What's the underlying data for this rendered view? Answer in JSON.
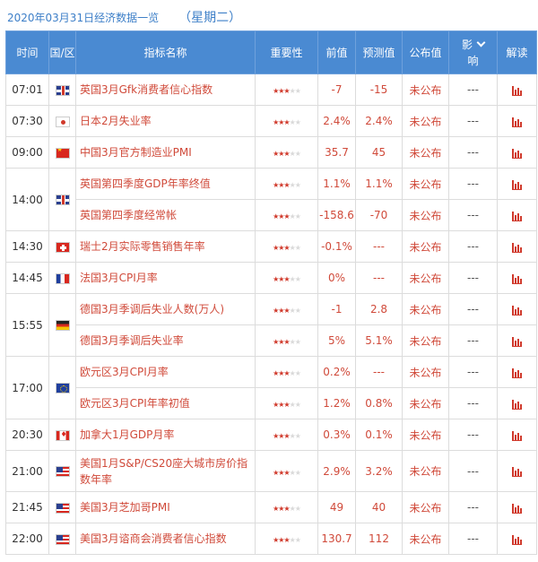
{
  "header": {
    "date_title": "2020年03月31日经济数据一览",
    "weekday": "（星期二）"
  },
  "columns": {
    "time": "时间",
    "country": "国/区",
    "indicator": "指标名称",
    "importance": "重要性",
    "previous": "前值",
    "forecast": "预测值",
    "actual": "公布值",
    "impact_1": "影",
    "impact_2": "响",
    "explain": "解读"
  },
  "groups": [
    {
      "time": "07:01",
      "flag": "gb",
      "rows": [
        {
          "name": "英国3月Gfk消费者信心指数",
          "stars": 3,
          "previous": "-7",
          "forecast": "-15",
          "actual": "未公布",
          "impact": "---"
        }
      ]
    },
    {
      "time": "07:30",
      "flag": "jp",
      "rows": [
        {
          "name": "日本2月失业率",
          "stars": 3,
          "previous": "2.4%",
          "forecast": "2.4%",
          "actual": "未公布",
          "impact": "---"
        }
      ]
    },
    {
      "time": "09:00",
      "flag": "cn",
      "rows": [
        {
          "name": "中国3月官方制造业PMI",
          "stars": 3,
          "previous": "35.7",
          "forecast": "45",
          "actual": "未公布",
          "impact": "---"
        }
      ]
    },
    {
      "time": "14:00",
      "flag": "gb",
      "rows": [
        {
          "name": "英国第四季度GDP年率终值",
          "stars": 3,
          "previous": "1.1%",
          "forecast": "1.1%",
          "actual": "未公布",
          "impact": "---"
        },
        {
          "name": "英国第四季度经常帐",
          "stars": 3,
          "previous": "-158.6",
          "forecast": "-70",
          "actual": "未公布",
          "impact": "---"
        }
      ]
    },
    {
      "time": "14:30",
      "flag": "ch",
      "rows": [
        {
          "name": "瑞士2月实际零售销售年率",
          "stars": 3,
          "previous": "-0.1%",
          "forecast": "---",
          "actual": "未公布",
          "impact": "---"
        }
      ]
    },
    {
      "time": "14:45",
      "flag": "fr",
      "rows": [
        {
          "name": "法国3月CPI月率",
          "stars": 3,
          "previous": "0%",
          "forecast": "---",
          "actual": "未公布",
          "impact": "---"
        }
      ]
    },
    {
      "time": "15:55",
      "flag": "de",
      "rows": [
        {
          "name": "德国3月季调后失业人数(万人)",
          "stars": 3,
          "previous": "-1",
          "forecast": "2.8",
          "actual": "未公布",
          "impact": "---"
        },
        {
          "name": "德国3月季调后失业率",
          "stars": 3,
          "previous": "5%",
          "forecast": "5.1%",
          "actual": "未公布",
          "impact": "---"
        }
      ]
    },
    {
      "time": "17:00",
      "flag": "eu",
      "rows": [
        {
          "name": "欧元区3月CPI月率",
          "stars": 3,
          "previous": "0.2%",
          "forecast": "---",
          "actual": "未公布",
          "impact": "---"
        },
        {
          "name": "欧元区3月CPI年率初值",
          "stars": 3,
          "previous": "1.2%",
          "forecast": "0.8%",
          "actual": "未公布",
          "impact": "---"
        }
      ]
    },
    {
      "time": "20:30",
      "flag": "ca",
      "rows": [
        {
          "name": "加拿大1月GDP月率",
          "stars": 3,
          "previous": "0.3%",
          "forecast": "0.1%",
          "actual": "未公布",
          "impact": "---"
        }
      ]
    },
    {
      "time": "21:00",
      "flag": "us",
      "tall": true,
      "rows": [
        {
          "name": "美国1月S&P/CS20座大城市房价指数年率",
          "stars": 3,
          "previous": "2.9%",
          "forecast": "3.2%",
          "actual": "未公布",
          "impact": "---"
        }
      ]
    },
    {
      "time": "21:45",
      "flag": "us",
      "rows": [
        {
          "name": "美国3月芝加哥PMI",
          "stars": 3,
          "previous": "49",
          "forecast": "40",
          "actual": "未公布",
          "impact": "---"
        }
      ]
    },
    {
      "time": "22:00",
      "flag": "us",
      "rows": [
        {
          "name": "美国3月谘商会消费者信心指数",
          "stars": 3,
          "previous": "130.7",
          "forecast": "112",
          "actual": "未公布",
          "impact": "---"
        }
      ]
    }
  ],
  "colors": {
    "header_bg": "#4a8ad2",
    "accent_red": "#d04a3a",
    "title_blue": "#3d7fc8"
  }
}
